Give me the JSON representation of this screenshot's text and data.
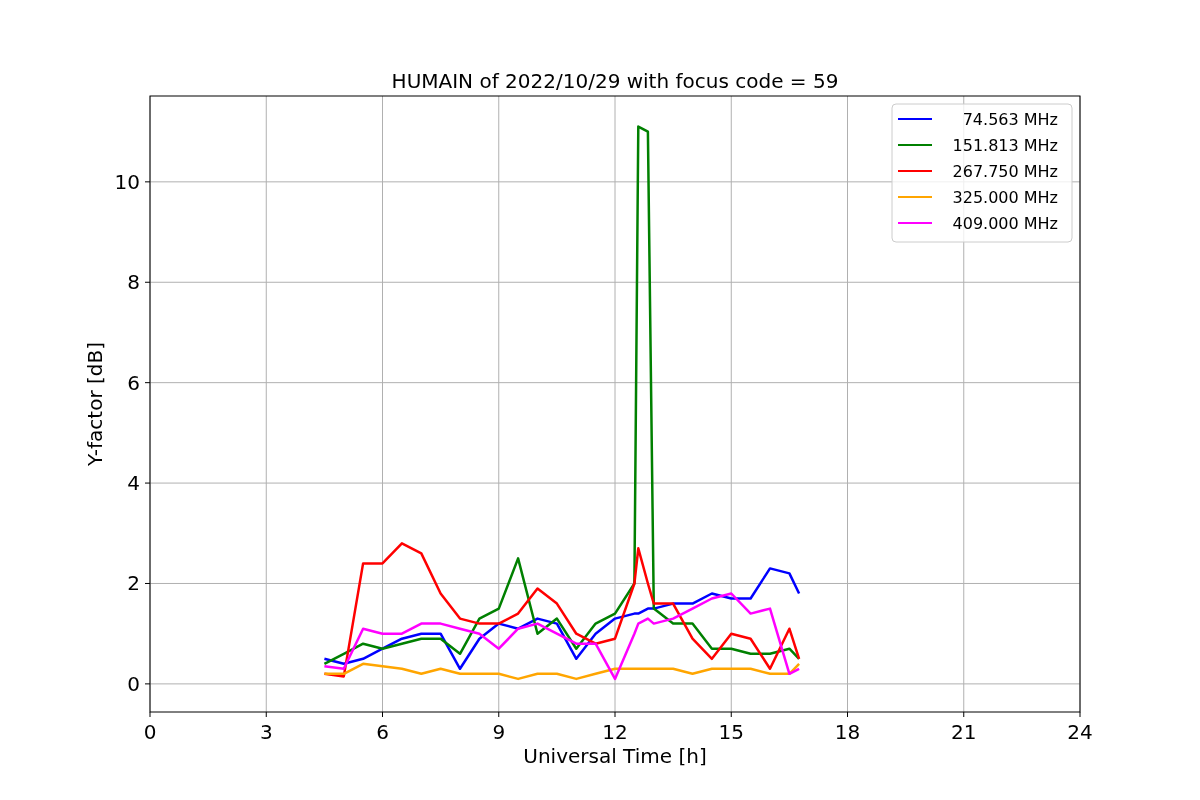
{
  "figure": {
    "chart_data": {
      "type": "line",
      "title": "HUMAIN of 2022/10/29 with focus code = 59",
      "xlabel": "Universal Time [h]",
      "ylabel": "Y-factor [dB]",
      "x": [
        4.5,
        5,
        5.5,
        6,
        6.5,
        7,
        7.5,
        8,
        8.5,
        9,
        9.5,
        10,
        10.5,
        11,
        11.5,
        12,
        12.5,
        12.6,
        12.85,
        13,
        13.5,
        14,
        14.5,
        15,
        15.5,
        16,
        16.5,
        16.75
      ],
      "series": [
        {
          "name": "74.563 MHz",
          "color": "#0000ff",
          "values": [
            0.5,
            0.4,
            0.5,
            0.7,
            0.9,
            1.0,
            1.0,
            0.3,
            0.9,
            1.2,
            1.1,
            1.3,
            1.2,
            0.5,
            1.0,
            1.3,
            1.4,
            1.4,
            1.5,
            1.5,
            1.6,
            1.6,
            1.8,
            1.7,
            1.7,
            2.3,
            2.2,
            1.8
          ]
        },
        {
          "name": "151.813 MHz",
          "color": "#008000",
          "values": [
            0.4,
            0.6,
            0.8,
            0.7,
            0.8,
            0.9,
            0.9,
            0.6,
            1.3,
            1.5,
            2.5,
            1.0,
            1.3,
            0.7,
            1.2,
            1.4,
            2.0,
            11.1,
            11.0,
            1.5,
            1.2,
            1.2,
            0.7,
            0.7,
            0.6,
            0.6,
            0.7,
            0.5
          ]
        },
        {
          "name": "267.750 MHz",
          "color": "#ff0000",
          "values": [
            0.2,
            0.15,
            2.4,
            2.4,
            2.8,
            2.6,
            1.8,
            1.3,
            1.2,
            1.2,
            1.4,
            1.9,
            1.6,
            1.0,
            0.8,
            0.9,
            2.0,
            2.7,
            2.0,
            1.6,
            1.6,
            0.9,
            0.5,
            1.0,
            0.9,
            0.3,
            1.1,
            0.5
          ]
        },
        {
          "name": "325.000 MHz",
          "color": "#ffa500",
          "values": [
            0.2,
            0.2,
            0.4,
            0.35,
            0.3,
            0.2,
            0.3,
            0.2,
            0.2,
            0.2,
            0.1,
            0.2,
            0.2,
            0.1,
            0.2,
            0.3,
            0.3,
            0.3,
            0.3,
            0.3,
            0.3,
            0.2,
            0.3,
            0.3,
            0.3,
            0.2,
            0.2,
            0.4
          ]
        },
        {
          "name": "409.000 MHz",
          "color": "#ff00ff",
          "values": [
            0.35,
            0.3,
            1.1,
            1.0,
            1.0,
            1.2,
            1.2,
            1.1,
            1.0,
            0.7,
            1.1,
            1.2,
            1.0,
            0.8,
            0.8,
            0.1,
            1.0,
            1.2,
            1.3,
            1.2,
            1.3,
            1.5,
            1.7,
            1.8,
            1.4,
            1.5,
            0.2,
            0.3
          ]
        }
      ],
      "grid": true,
      "legend": true,
      "xlim": [
        0,
        24
      ],
      "ylim": [
        -0.56,
        11.71
      ],
      "xticks": [
        0,
        3,
        6,
        9,
        12,
        15,
        18,
        21,
        24
      ],
      "yticks": [
        0,
        2,
        4,
        6,
        8,
        10
      ]
    }
  }
}
